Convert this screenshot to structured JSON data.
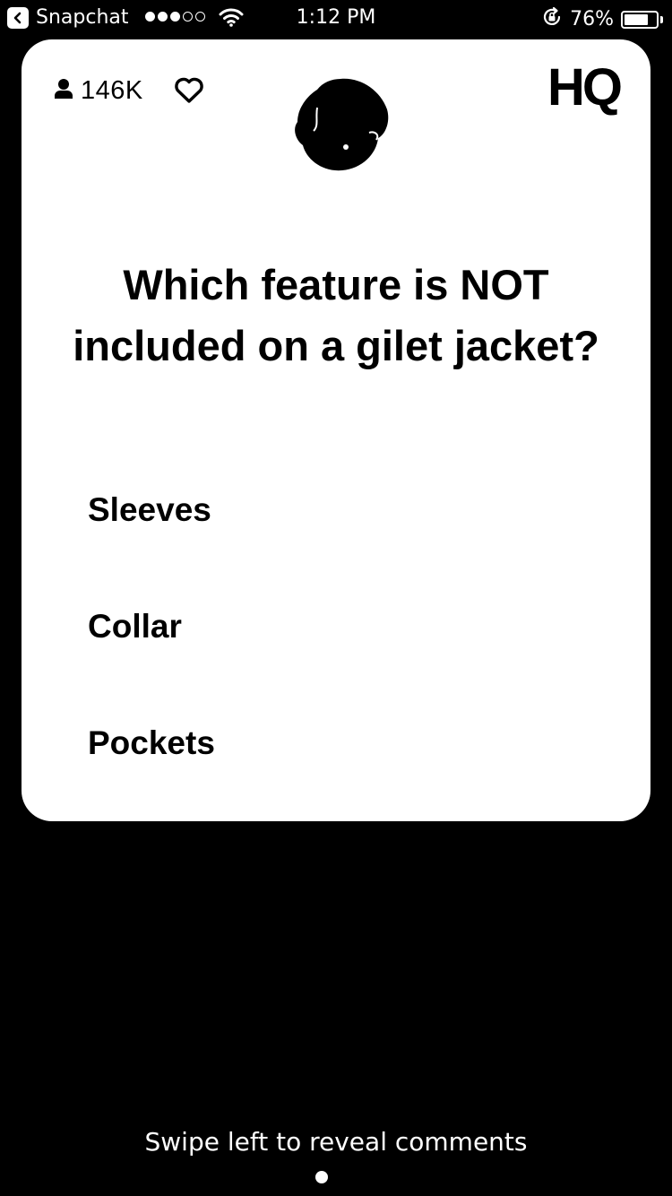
{
  "status_bar": {
    "back_app_label": "Snapchat",
    "signal_bars_filled": 3,
    "signal_bars_total": 5,
    "time": "1:12 PM",
    "battery_percent_label": "76%",
    "battery_level": 0.76
  },
  "card": {
    "viewer_count": "146K",
    "logo": "HQ",
    "question": "Which feature is NOT included on a gilet jacket?",
    "answers": [
      {
        "label": "Sleeves"
      },
      {
        "label": "Collar"
      },
      {
        "label": "Pockets"
      }
    ]
  },
  "footer": {
    "swipe_hint": "Swipe left to reveal comments"
  },
  "colors": {
    "background": "#000000",
    "card": "#ffffff",
    "text_on_card": "#000000",
    "text_on_background": "#ffffff"
  },
  "icons": {
    "back": "chevron-left-icon",
    "wifi": "wifi-icon",
    "orientation_lock": "rotation-lock-icon",
    "viewers": "person-icon",
    "like": "heart-icon"
  }
}
